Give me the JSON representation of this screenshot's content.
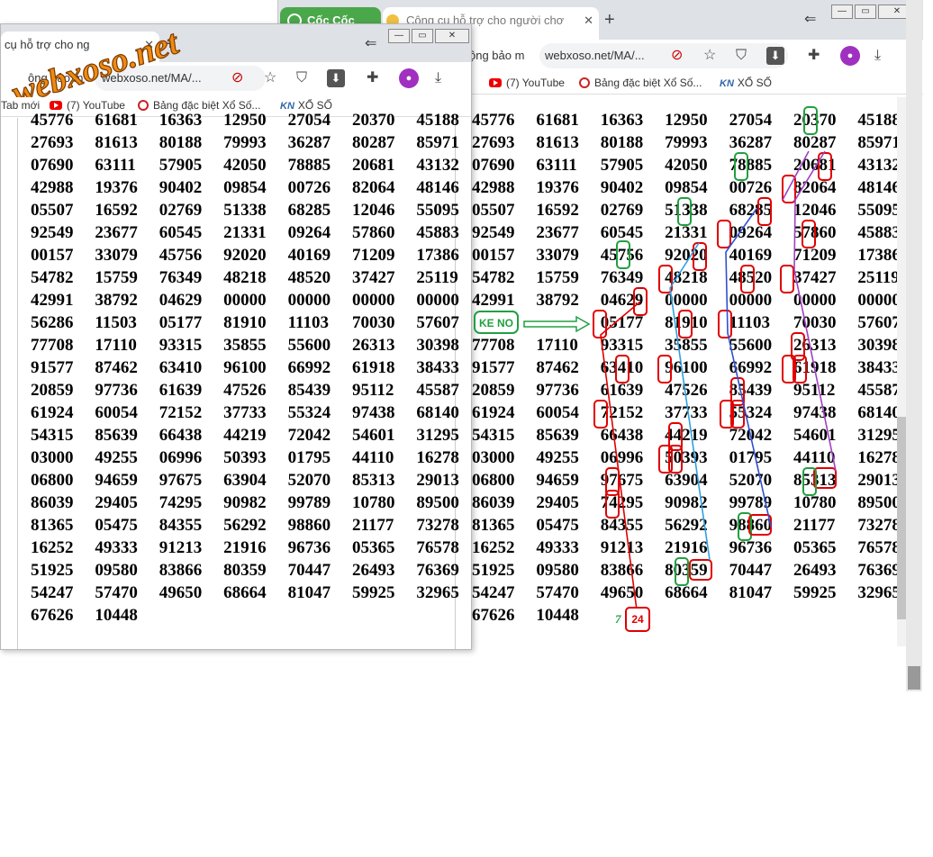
{
  "window_right": {
    "tab1_label": "Cốc Cốc",
    "tab2_title": "Công cụ hỗ trợ cho người chơ",
    "tab_close": "✕",
    "new_tab": "+",
    "url": "webxoso.net/MA/...",
    "omnibox_prefix": "ộng bảo m",
    "bookmarks": [
      "(7) YouTube",
      "Bảng đặc biệt Xổ Số...",
      "XỔ SỐ"
    ],
    "bookmark_prefix": "i"
  },
  "window_left": {
    "tab_title": "cụ hỗ trợ cho ng",
    "tab_close": "✕",
    "new_tab": "+",
    "url": "webxoso.net/MA/...",
    "omnibox_prefix": "ộng bảo m",
    "bookmarks": [
      "Tab mới",
      "(7) YouTube",
      "Bảng đặc biệt Xổ Số...",
      "XỔ SỐ"
    ]
  },
  "watermark": "webxoso.net",
  "annotations": {
    "ke_no_label": "KE NO",
    "count_seven": "7",
    "count_box": "24",
    "colors": {
      "red": "#e00000",
      "green": "#20a040",
      "blue": "#3050d0",
      "cyan": "#30a0e0",
      "purple": "#a040c0"
    }
  },
  "table_left": [
    [
      "45776",
      "61681",
      "16363",
      "12950",
      "27054",
      "20370",
      "45188"
    ],
    [
      "27693",
      "81613",
      "80188",
      "79993",
      "36287",
      "80287",
      "85971"
    ],
    [
      "07690",
      "63111",
      "57905",
      "42050",
      "78885",
      "20681",
      "43132"
    ],
    [
      "42988",
      "19376",
      "90402",
      "09854",
      "00726",
      "82064",
      "48146"
    ],
    [
      "05507",
      "16592",
      "02769",
      "51338",
      "68285",
      "12046",
      "55095"
    ],
    [
      "92549",
      "23677",
      "60545",
      "21331",
      "09264",
      "57860",
      "45883"
    ],
    [
      "00157",
      "33079",
      "45756",
      "92020",
      "40169",
      "71209",
      "17386"
    ],
    [
      "54782",
      "15759",
      "76349",
      "48218",
      "48520",
      "37427",
      "25119"
    ],
    [
      "42991",
      "38792",
      "04629",
      "00000",
      "00000",
      "00000",
      "00000"
    ],
    [
      "56286",
      "11503",
      "05177",
      "81910",
      "11103",
      "70030",
      "57607"
    ],
    [
      "77708",
      "17110",
      "93315",
      "35855",
      "55600",
      "26313",
      "30398"
    ],
    [
      "91577",
      "87462",
      "63410",
      "96100",
      "66992",
      "61918",
      "38433"
    ],
    [
      "20859",
      "97736",
      "61639",
      "47526",
      "85439",
      "95112",
      "45587"
    ],
    [
      "61924",
      "60054",
      "72152",
      "37733",
      "55324",
      "97438",
      "68140"
    ],
    [
      "54315",
      "85639",
      "66438",
      "44219",
      "72042",
      "54601",
      "31295"
    ],
    [
      "03000",
      "49255",
      "06996",
      "50393",
      "01795",
      "44110",
      "16278"
    ],
    [
      "06800",
      "94659",
      "97675",
      "63904",
      "52070",
      "85313",
      "29013"
    ],
    [
      "86039",
      "29405",
      "74295",
      "90982",
      "99789",
      "10780",
      "89500"
    ],
    [
      "81365",
      "05475",
      "84355",
      "56292",
      "98860",
      "21177",
      "73278"
    ],
    [
      "16252",
      "49333",
      "91213",
      "21916",
      "96736",
      "05365",
      "76578"
    ],
    [
      "51925",
      "09580",
      "83866",
      "80359",
      "70447",
      "26493",
      "76369"
    ],
    [
      "54247",
      "57470",
      "49650",
      "68664",
      "81047",
      "59925",
      "32965"
    ],
    [
      "67626",
      "10448",
      "",
      "",
      "",
      "",
      ""
    ]
  ],
  "table_right": [
    [
      "45776",
      "61681",
      "16363",
      "12950",
      "27054",
      "20370",
      "45188"
    ],
    [
      "27693",
      "81613",
      "80188",
      "79993",
      "36287",
      "80287",
      "85971"
    ],
    [
      "07690",
      "63111",
      "57905",
      "42050",
      "78885",
      "20681",
      "43132"
    ],
    [
      "42988",
      "19376",
      "90402",
      "09854",
      "00726",
      "82064",
      "48146"
    ],
    [
      "05507",
      "16592",
      "02769",
      "51338",
      "68285",
      "12046",
      "55095"
    ],
    [
      "92549",
      "23677",
      "60545",
      "21331",
      "09264",
      "57860",
      "45883"
    ],
    [
      "00157",
      "33079",
      "45756",
      "92020",
      "40169",
      "71209",
      "17386"
    ],
    [
      "54782",
      "15759",
      "76349",
      "48218",
      "48520",
      "37427",
      "25119"
    ],
    [
      "42991",
      "38792",
      "04629",
      "00000",
      "00000",
      "00000",
      "00000"
    ],
    [
      "",
      "",
      "05177",
      "81910",
      "11103",
      "70030",
      "57607"
    ],
    [
      "77708",
      "17110",
      "93315",
      "35855",
      "55600",
      "26313",
      "30398"
    ],
    [
      "91577",
      "87462",
      "63410",
      "96100",
      "66992",
      "61918",
      "38433"
    ],
    [
      "20859",
      "97736",
      "61639",
      "47526",
      "85439",
      "95112",
      "45587"
    ],
    [
      "61924",
      "60054",
      "72152",
      "37733",
      "55324",
      "97438",
      "68140"
    ],
    [
      "54315",
      "85639",
      "66438",
      "44219",
      "72042",
      "54601",
      "31295"
    ],
    [
      "03000",
      "49255",
      "06996",
      "50393",
      "01795",
      "44110",
      "16278"
    ],
    [
      "06800",
      "94659",
      "97675",
      "63904",
      "52070",
      "85313",
      "29013"
    ],
    [
      "86039",
      "29405",
      "74295",
      "90982",
      "99789",
      "10780",
      "89500"
    ],
    [
      "81365",
      "05475",
      "84355",
      "56292",
      "98860",
      "21177",
      "73278"
    ],
    [
      "16252",
      "49333",
      "91213",
      "21916",
      "96736",
      "05365",
      "76578"
    ],
    [
      "51925",
      "09580",
      "83866",
      "80359",
      "70447",
      "26493",
      "76369"
    ],
    [
      "54247",
      "57470",
      "49650",
      "68664",
      "81047",
      "59925",
      "32965"
    ],
    [
      "67626",
      "10448",
      "",
      "",
      "",
      "",
      ""
    ]
  ]
}
